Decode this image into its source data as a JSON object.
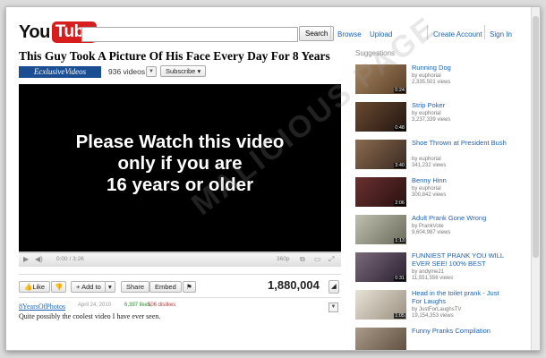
{
  "header": {
    "logo_you": "You",
    "logo_tube": "Tube",
    "search_value": "",
    "search_button": "Search",
    "nav": [
      "Browse",
      "Upload"
    ],
    "account": [
      "Create Account",
      "Sign In"
    ]
  },
  "video": {
    "title": "This Guy Took A Picture Of His Face Every Day For 8 Years",
    "channel": "EcxlusiveVideos",
    "video_count": "936 videos",
    "subscribe": "Subscribe",
    "player_message": "Please Watch this video\nonly if you are\n16 years or older",
    "time": "0:00 / 3:26",
    "quality": "360p",
    "views": "1,880,004",
    "uploader": "8YearsOfPhotos",
    "date": "April 24, 2010",
    "likes": "6,397 likes,",
    "dislikes": "506 dislikes",
    "description": "Quite possibly the coolest video I have ever seen."
  },
  "actions": {
    "like": "Like",
    "add_to": "Add to",
    "share": "Share",
    "embed": "Embed"
  },
  "suggestions_heading": "Suggestions",
  "suggestions": [
    {
      "title": "Running Dog",
      "by": "by euphorial",
      "views": "2,335,501 views",
      "duration": "0:24",
      "color": "#7a5a3a"
    },
    {
      "title": "Strip Poker",
      "by": "by euphorial",
      "views": "3,237,339 views",
      "duration": "0:48",
      "color": "#3a2b22"
    },
    {
      "title": "Shoe Thrown at President Bush",
      "by": "by euphorial",
      "views": "341,232 views",
      "duration": "3:40",
      "color": "#6b4e3a"
    },
    {
      "title": "Benny Hinn",
      "by": "by euphorial",
      "views": "300,842 views",
      "duration": "2:06",
      "color": "#4a2a2a"
    },
    {
      "title": "Adult Prank Gone Wrong",
      "by": "by PrankVote",
      "views": "9,604,987 views",
      "duration": "1:13",
      "color": "#9a9a8a"
    },
    {
      "title": "FUNNIEST PRANK YOU WILL EVER SEE! 100% BEST",
      "by": "by andyme21",
      "views": "11,551,556 views",
      "duration": "0:31",
      "color": "#5a4a5a"
    },
    {
      "title": "Head in the toilet prank - Just For Laughs",
      "by": "by JustForLaughsTV",
      "views": "19,154,353 views",
      "duration": "1:05",
      "color": "#c8c0b0"
    },
    {
      "title": "Funny Pranks Compilation",
      "by": "",
      "views": "",
      "duration": "",
      "color": "#8a7a6a"
    }
  ],
  "watermark": "MALICIOUS PAGE"
}
